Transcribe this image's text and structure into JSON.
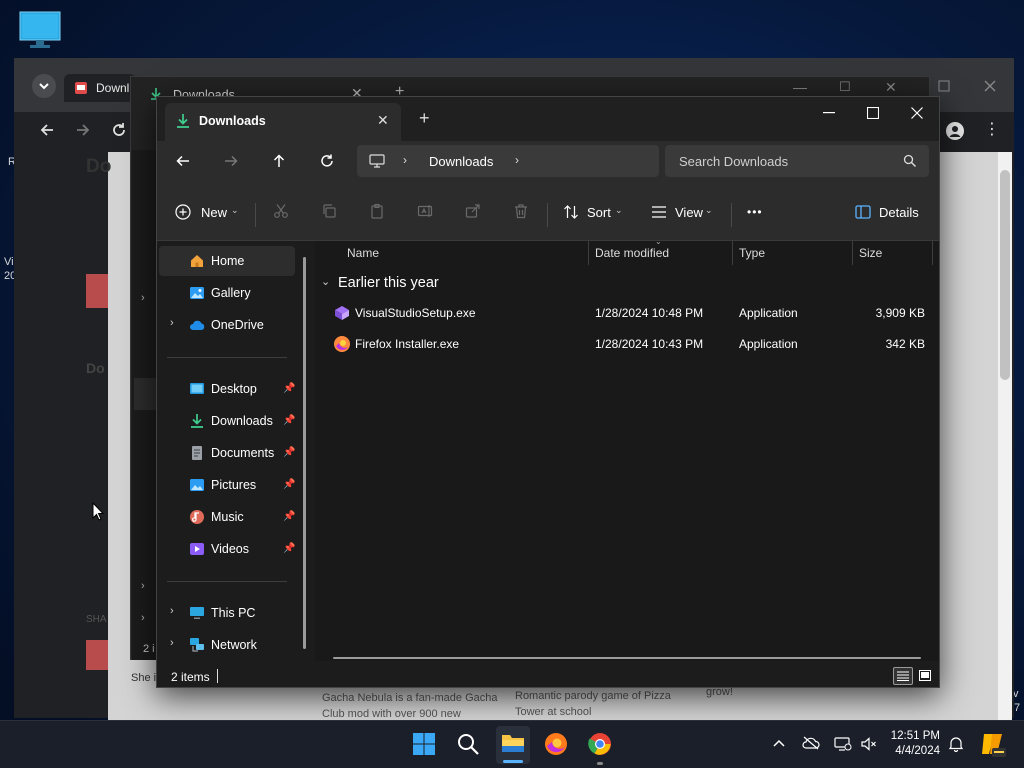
{
  "explorer": {
    "tab_title": "Downloads",
    "address": {
      "crumb": "Downloads"
    },
    "search": {
      "placeholder": "Search Downloads"
    },
    "toolbar": {
      "new_label": "New",
      "sort_label": "Sort",
      "view_label": "View",
      "more_label": "•••",
      "details_label": "Details"
    },
    "nav": {
      "home": "Home",
      "gallery": "Gallery",
      "onedrive": "OneDrive",
      "desktop": "Desktop",
      "downloads": "Downloads",
      "documents": "Documents",
      "pictures": "Pictures",
      "music": "Music",
      "videos": "Videos",
      "this_pc": "This PC",
      "network": "Network"
    },
    "columns": {
      "name": "Name",
      "date": "Date modified",
      "type": "Type",
      "size": "Size"
    },
    "group": "Earlier this year",
    "files": [
      {
        "name": "VisualStudioSetup.exe",
        "date": "1/28/2024 10:48 PM",
        "type": "Application",
        "size": "3,909 KB"
      },
      {
        "name": "Firefox Installer.exe",
        "date": "1/28/2024 10:43 PM",
        "type": "Application",
        "size": "342 KB"
      }
    ],
    "status": "2 items"
  },
  "browser": {
    "tab_title": "Downl",
    "back_window_tab": "Downloads",
    "page_texts": {
      "heading1": "Do",
      "heading2": "Do",
      "card_text1": "Gacha Nebula is a fan-made Gacha",
      "card_text2": "Club mod with over 900 new",
      "card_text3": "Romantic parody game of Pizza",
      "card_text4": "Tower at school",
      "card_text5": "grow!",
      "share_label": "SHA",
      "side_text": "She i",
      "items_partial": "2 i"
    }
  },
  "desktop": {
    "edge_r": "R",
    "edge_vi": "Vi",
    "edge_20": "20",
    "edge_right1": "v",
    "edge_right2": "7"
  },
  "taskbar": {
    "time": "12:51 PM",
    "date": "4/4/2024",
    "apps": [
      "start-icon",
      "search-icon",
      "file-explorer-icon",
      "firefox-icon",
      "chrome-icon"
    ]
  }
}
